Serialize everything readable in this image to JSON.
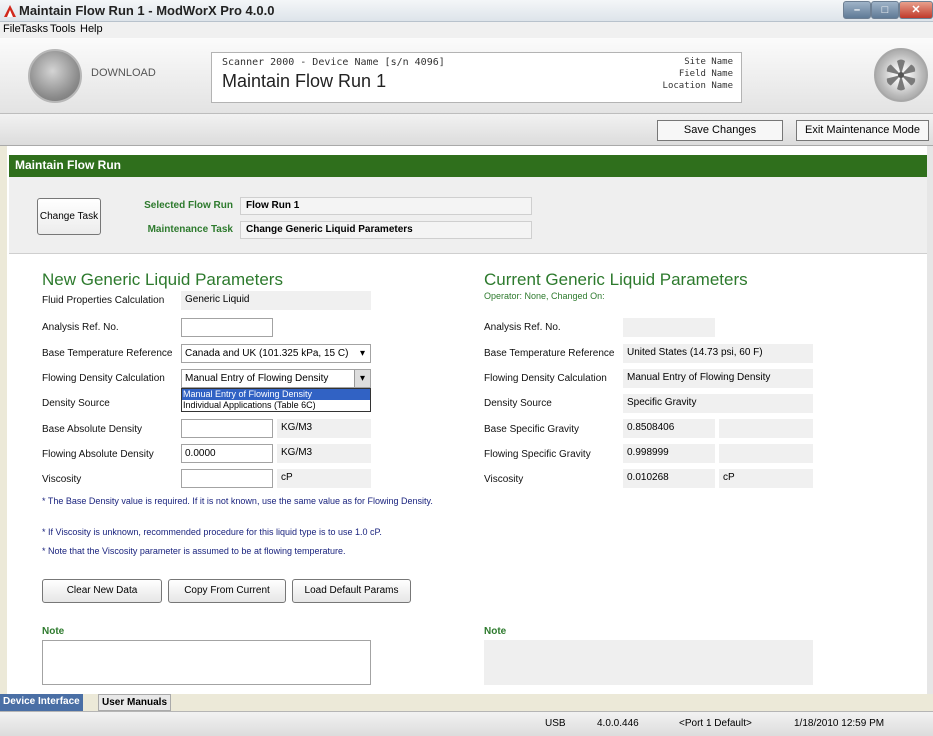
{
  "window": {
    "title": "Maintain Flow Run 1 - ModWorX Pro 4.0.0"
  },
  "menu": [
    "File",
    "Tasks",
    "Tools",
    "Help"
  ],
  "header": {
    "download_label": "DOWNLOAD",
    "device_line": "Scanner 2000 - Device Name [s/n 4096]",
    "title": "Maintain Flow Run 1",
    "site": "Site Name",
    "field": "Field Name",
    "location": "Location Name"
  },
  "toolbar": {
    "save": "Save Changes",
    "exit": "Exit Maintenance Mode"
  },
  "panel": {
    "title": "Maintain Flow Run"
  },
  "task": {
    "change_task": "Change Task",
    "selected_flow_run_label": "Selected Flow Run",
    "selected_flow_run": "Flow Run 1",
    "maintenance_task_label": "Maintenance Task",
    "maintenance_task": "Change Generic Liquid Parameters"
  },
  "new": {
    "title": "New Generic Liquid Parameters",
    "fluid_label": "Fluid Properties Calculation",
    "fluid_value": "Generic Liquid",
    "analysis_label": "Analysis Ref. No.",
    "analysis_value": "",
    "base_temp_label": "Base Temperature Reference",
    "base_temp_value": "Canada and UK (101.325 kPa, 15 C)",
    "flowing_density_label": "Flowing Density Calculation",
    "flowing_density_value": "Manual Entry of Flowing Density",
    "dropdown_options": [
      "Manual Entry of Flowing Density",
      "Individual Applications (Table 6C)"
    ],
    "density_source_label": "Density Source",
    "base_abs_label": "Base Absolute Density",
    "base_abs_value": "",
    "base_abs_unit": "KG/M3",
    "flowing_abs_label": "Flowing Absolute Density",
    "flowing_abs_value": "0.0000",
    "flowing_abs_unit": "KG/M3",
    "viscosity_label": "Viscosity",
    "viscosity_value": "",
    "viscosity_unit": "cP",
    "note1": "* The Base Density value is required. If it is not known, use the same value as for Flowing Density.",
    "note2": "* If Viscosity is unknown, recommended procedure for this liquid type is to use 1.0 cP.",
    "note3": "* Note that the Viscosity parameter is assumed to be at flowing temperature.",
    "clear_btn": "Clear New Data",
    "copy_btn": "Copy From Current",
    "load_btn": "Load Default Params",
    "note_label": "Note"
  },
  "current": {
    "title": "Current Generic Liquid Parameters",
    "operator": "Operator: None, Changed On:",
    "analysis_label": "Analysis Ref. No.",
    "analysis_value": "",
    "base_temp_label": "Base Temperature Reference",
    "base_temp_value": "United States (14.73 psi, 60 F)",
    "flowing_density_label": "Flowing Density Calculation",
    "flowing_density_value": "Manual Entry of Flowing Density",
    "density_source_label": "Density Source",
    "density_source_value": "Specific Gravity",
    "base_sg_label": "Base Specific Gravity",
    "base_sg_value": "0.8508406",
    "flowing_sg_label": "Flowing Specific Gravity",
    "flowing_sg_value": "0.998999",
    "viscosity_label": "Viscosity",
    "viscosity_value": "0.010268",
    "viscosity_unit": "cP",
    "note_label": "Note"
  },
  "tabs": [
    "Device Interface",
    "User Manuals"
  ],
  "status": {
    "connection": "USB",
    "version": "4.0.0.446",
    "port": "<Port 1 Default>",
    "datetime": "1/18/2010 12:59 PM"
  },
  "colors": {
    "accent_green": "#2f6f1c",
    "label_green": "#2d7a2d",
    "dropdown_select": "#3162c4"
  }
}
